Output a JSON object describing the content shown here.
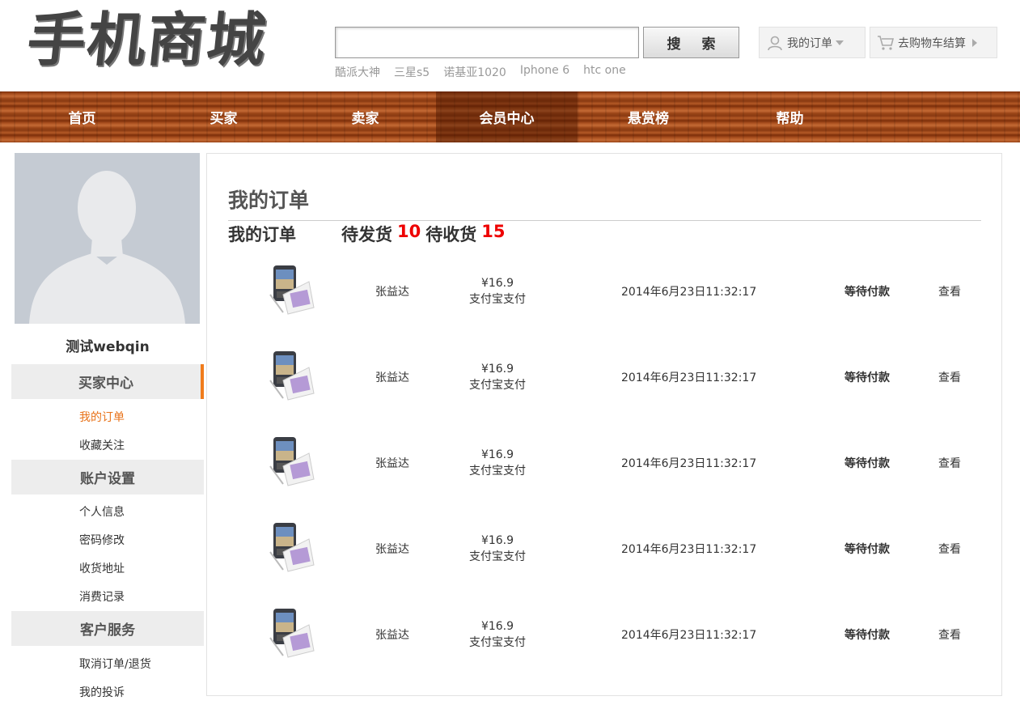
{
  "header": {
    "logo": "手机商城",
    "search": {
      "value": "",
      "placeholder": "",
      "button": "搜 索"
    },
    "hot_keywords": [
      "酷派大神",
      "三星s5",
      "诺基亚1020",
      "Iphone 6",
      "htc one"
    ],
    "my_orders": "我的订单",
    "cart": "去购物车结算"
  },
  "nav": {
    "items": [
      "首页",
      "买家",
      "卖家",
      "会员中心",
      "悬赏榜",
      "帮助"
    ],
    "active": "会员中心"
  },
  "sidebar": {
    "username": "测试webqin",
    "sections": [
      {
        "title": "买家中心",
        "links": [
          "我的订单",
          "收藏关注"
        ]
      },
      {
        "title": "账户设置",
        "links": [
          "个人信息",
          "密码修改",
          "收货地址",
          "消费记录"
        ]
      },
      {
        "title": "客户服务",
        "links": [
          "取消订单/退货",
          "我的投诉"
        ]
      }
    ],
    "active_link": "我的订单"
  },
  "main": {
    "title": "我的订单",
    "summary": {
      "label": "我的订单",
      "pending_ship_label": "待发货",
      "pending_ship": "10",
      "pending_receive_label": "待收货",
      "pending_receive": "15"
    },
    "orders": [
      {
        "seller": "张益达",
        "price": "¥16.9",
        "payment": "支付宝支付",
        "time": "2014年6月23日11:32:17",
        "status": "等待付款",
        "action": "查看"
      },
      {
        "seller": "张益达",
        "price": "¥16.9",
        "payment": "支付宝支付",
        "time": "2014年6月23日11:32:17",
        "status": "等待付款",
        "action": "查看"
      },
      {
        "seller": "张益达",
        "price": "¥16.9",
        "payment": "支付宝支付",
        "time": "2014年6月23日11:32:17",
        "status": "等待付款",
        "action": "查看"
      },
      {
        "seller": "张益达",
        "price": "¥16.9",
        "payment": "支付宝支付",
        "time": "2014年6月23日11:32:17",
        "status": "等待付款",
        "action": "查看"
      },
      {
        "seller": "张益达",
        "price": "¥16.9",
        "payment": "支付宝支付",
        "time": "2014年6月23日11:32:17",
        "status": "等待付款",
        "action": "查看"
      }
    ]
  },
  "colors": {
    "accent": "#f07c1c",
    "count_red": "#ee0000",
    "nav_wood": "#a9501f"
  }
}
